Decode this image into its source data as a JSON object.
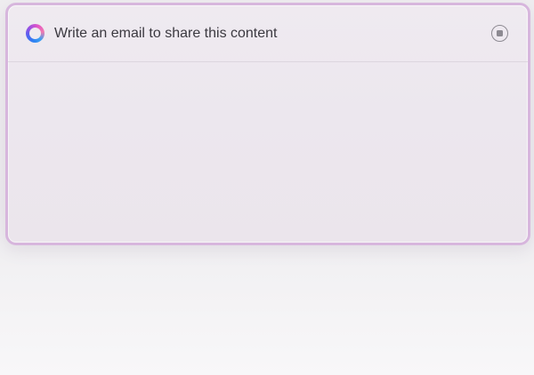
{
  "prompt": {
    "text": "Write an email to share this content",
    "icon": "copilot-icon",
    "stop_icon": "stop-icon"
  },
  "colors": {
    "panel_border": "#d7b6dd",
    "panel_background": "#ece7ee",
    "text": "#3b3940",
    "stop_icon": "#8d8a92"
  }
}
